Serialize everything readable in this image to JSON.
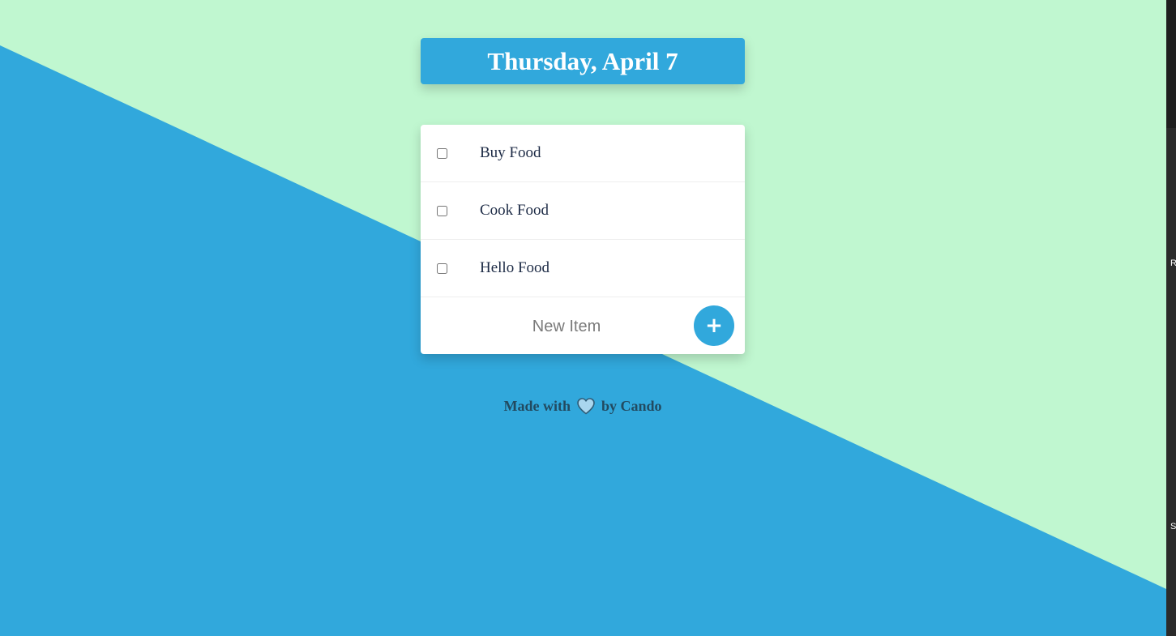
{
  "colors": {
    "mint": "#c0f7d0",
    "blue": "#31a8dc",
    "card": "#ffffff",
    "item_text": "#1c2a45",
    "footer_text": "#224a60"
  },
  "header": {
    "date": "Thursday, April 7"
  },
  "todo": {
    "items": [
      {
        "label": "Buy Food",
        "checked": false
      },
      {
        "label": "Cook Food",
        "checked": false
      },
      {
        "label": "Hello Food",
        "checked": false
      }
    ],
    "new_item_placeholder": "New Item",
    "add_button_label": "+"
  },
  "footer": {
    "prefix": "Made with",
    "icon": "heart-icon",
    "suffix": "by Cando"
  },
  "edge_fragments": [
    "R",
    "S"
  ]
}
